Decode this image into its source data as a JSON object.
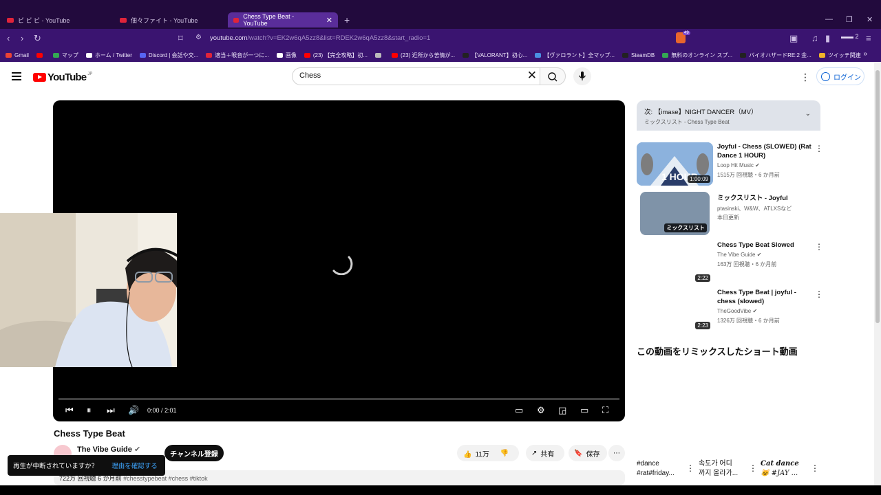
{
  "browser": {
    "tabs": [
      {
        "label": "ビ ビ ビ - YouTube"
      },
      {
        "label": "佃々ファイト - YouTube"
      },
      {
        "label": "Chess Type Beat - YouTube",
        "active": true
      }
    ],
    "new_tab": "+",
    "url_host": "youtube.com",
    "url_rest": "/watch?v=EK2w6qA5zz8&list=RDEK2w6qA5zz8&start_radio=1",
    "brave_badge": "49",
    "wallet_count": "2",
    "bookmarks": [
      {
        "label": "Gmail",
        "color": "#ea4335"
      },
      {
        "label": "",
        "color": "#ff0000"
      },
      {
        "label": "マップ",
        "color": "#34a853"
      },
      {
        "label": "ホーム / Twitter",
        "color": "#ffffff"
      },
      {
        "label": "Discord | 会話や交...",
        "color": "#5865f2"
      },
      {
        "label": "適当＋喉音が一つに...",
        "color": "#e0243a"
      },
      {
        "label": "画像",
        "color": "#ffffff"
      },
      {
        "label": "(23) 【完全攻略】初...",
        "color": "#ff0000"
      },
      {
        "label": "",
        "color": "#bbbbbb"
      },
      {
        "label": "(23) 近所から苦情が...",
        "color": "#ff0000"
      },
      {
        "label": "【VALORANT】初心...",
        "color": "#222222"
      },
      {
        "label": "【ヴァロラント】全マップ...",
        "color": "#4a90e2"
      },
      {
        "label": "SteamDB",
        "color": "#222222"
      },
      {
        "label": "無料のオンライン スプ...",
        "color": "#34a853"
      },
      {
        "label": "バイオハザードRE:2 金...",
        "color": "#222222"
      },
      {
        "label": "ツイッチ関連",
        "color": "#f0b429"
      }
    ]
  },
  "header": {
    "logo_text": "YouTube",
    "logo_region": "JP",
    "search_value": "Chess",
    "login_label": "ログイン"
  },
  "player": {
    "time": "0:00 / 2:01",
    "progress": 0
  },
  "video": {
    "title": "Chess Type Beat",
    "channel": "The Vibe Guide",
    "subscribe_label": "チャンネル登録",
    "likes": "11万",
    "share_label": "共有",
    "save_label": "保存",
    "views": "722万 回視聴",
    "age": "6 か月前",
    "tags": "#chesstypebeat #chess #tiktok"
  },
  "toast": {
    "message": "再生が中断されていますか？",
    "link": "理由を確認する"
  },
  "upnext": {
    "title": "次: 【imase】NIGHT DANCER（MV）",
    "subtitle": "ミックスリスト - Chess Type Beat"
  },
  "recommendations": [
    {
      "title": "Joyful - Chess (SLOWED) (Rat Dance 1 HOUR)",
      "channel": "Loop Hit Music",
      "meta": "1515万 回視聴・6 か月前",
      "duration": "1:00:09",
      "thumb_text": "1 HOUR"
    },
    {
      "title": "ミックスリスト - Joyful",
      "channel": "ptasinski、W&W、ATLXSなど",
      "meta": "本日更新",
      "duration": "ミックスリスト"
    },
    {
      "title": "Chess Type Beat Slowed",
      "channel": "The Vibe Guide",
      "meta": "163万 回視聴・6 か月前",
      "duration": "2:22"
    },
    {
      "title": "Chess Type Beat | joyful - chess (slowed)",
      "channel": "TheGoodVibe",
      "meta": "1326万 回視聴・6 か月前",
      "duration": "2:23"
    }
  ],
  "shorts": {
    "heading": "この動画をリミックスしたショート動画",
    "items": [
      {
        "line1": "#dance",
        "line2": "#rat#friday..."
      },
      {
        "line1": "속도가 어디",
        "line2": "까지 올라가..."
      },
      {
        "line1": "Cat dance",
        "line2": "😺 #JAY ..."
      }
    ]
  }
}
